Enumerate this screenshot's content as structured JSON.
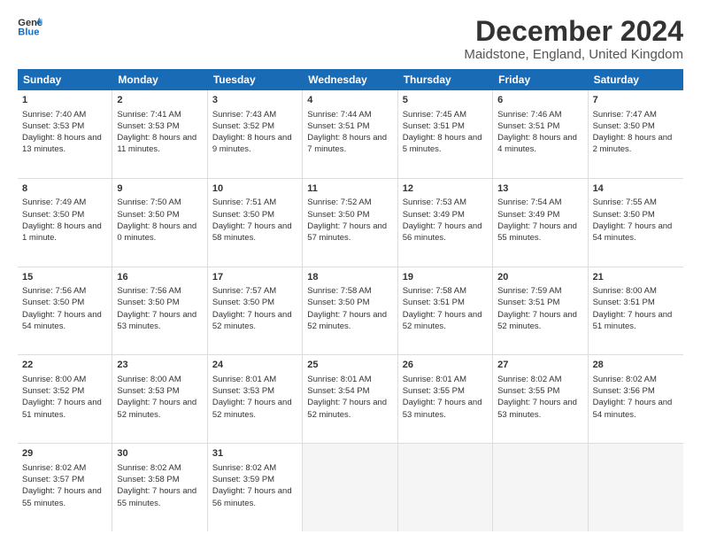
{
  "logo": {
    "line1": "General",
    "line2": "Blue"
  },
  "title": "December 2024",
  "subtitle": "Maidstone, England, United Kingdom",
  "header_days": [
    "Sunday",
    "Monday",
    "Tuesday",
    "Wednesday",
    "Thursday",
    "Friday",
    "Saturday"
  ],
  "weeks": [
    [
      {
        "day": "1",
        "rise": "7:40 AM",
        "set": "3:53 PM",
        "daylight": "8 hours and 13 minutes."
      },
      {
        "day": "2",
        "rise": "7:41 AM",
        "set": "3:53 PM",
        "daylight": "8 hours and 11 minutes."
      },
      {
        "day": "3",
        "rise": "7:43 AM",
        "set": "3:52 PM",
        "daylight": "8 hours and 9 minutes."
      },
      {
        "day": "4",
        "rise": "7:44 AM",
        "set": "3:51 PM",
        "daylight": "8 hours and 7 minutes."
      },
      {
        "day": "5",
        "rise": "7:45 AM",
        "set": "3:51 PM",
        "daylight": "8 hours and 5 minutes."
      },
      {
        "day": "6",
        "rise": "7:46 AM",
        "set": "3:51 PM",
        "daylight": "8 hours and 4 minutes."
      },
      {
        "day": "7",
        "rise": "7:47 AM",
        "set": "3:50 PM",
        "daylight": "8 hours and 2 minutes."
      }
    ],
    [
      {
        "day": "8",
        "rise": "7:49 AM",
        "set": "3:50 PM",
        "daylight": "8 hours and 1 minute."
      },
      {
        "day": "9",
        "rise": "7:50 AM",
        "set": "3:50 PM",
        "daylight": "8 hours and 0 minutes."
      },
      {
        "day": "10",
        "rise": "7:51 AM",
        "set": "3:50 PM",
        "daylight": "7 hours and 58 minutes."
      },
      {
        "day": "11",
        "rise": "7:52 AM",
        "set": "3:50 PM",
        "daylight": "7 hours and 57 minutes."
      },
      {
        "day": "12",
        "rise": "7:53 AM",
        "set": "3:49 PM",
        "daylight": "7 hours and 56 minutes."
      },
      {
        "day": "13",
        "rise": "7:54 AM",
        "set": "3:49 PM",
        "daylight": "7 hours and 55 minutes."
      },
      {
        "day": "14",
        "rise": "7:55 AM",
        "set": "3:50 PM",
        "daylight": "7 hours and 54 minutes."
      }
    ],
    [
      {
        "day": "15",
        "rise": "7:56 AM",
        "set": "3:50 PM",
        "daylight": "7 hours and 54 minutes."
      },
      {
        "day": "16",
        "rise": "7:56 AM",
        "set": "3:50 PM",
        "daylight": "7 hours and 53 minutes."
      },
      {
        "day": "17",
        "rise": "7:57 AM",
        "set": "3:50 PM",
        "daylight": "7 hours and 52 minutes."
      },
      {
        "day": "18",
        "rise": "7:58 AM",
        "set": "3:50 PM",
        "daylight": "7 hours and 52 minutes."
      },
      {
        "day": "19",
        "rise": "7:58 AM",
        "set": "3:51 PM",
        "daylight": "7 hours and 52 minutes."
      },
      {
        "day": "20",
        "rise": "7:59 AM",
        "set": "3:51 PM",
        "daylight": "7 hours and 52 minutes."
      },
      {
        "day": "21",
        "rise": "8:00 AM",
        "set": "3:51 PM",
        "daylight": "7 hours and 51 minutes."
      }
    ],
    [
      {
        "day": "22",
        "rise": "8:00 AM",
        "set": "3:52 PM",
        "daylight": "7 hours and 51 minutes."
      },
      {
        "day": "23",
        "rise": "8:00 AM",
        "set": "3:53 PM",
        "daylight": "7 hours and 52 minutes."
      },
      {
        "day": "24",
        "rise": "8:01 AM",
        "set": "3:53 PM",
        "daylight": "7 hours and 52 minutes."
      },
      {
        "day": "25",
        "rise": "8:01 AM",
        "set": "3:54 PM",
        "daylight": "7 hours and 52 minutes."
      },
      {
        "day": "26",
        "rise": "8:01 AM",
        "set": "3:55 PM",
        "daylight": "7 hours and 53 minutes."
      },
      {
        "day": "27",
        "rise": "8:02 AM",
        "set": "3:55 PM",
        "daylight": "7 hours and 53 minutes."
      },
      {
        "day": "28",
        "rise": "8:02 AM",
        "set": "3:56 PM",
        "daylight": "7 hours and 54 minutes."
      }
    ],
    [
      {
        "day": "29",
        "rise": "8:02 AM",
        "set": "3:57 PM",
        "daylight": "7 hours and 55 minutes."
      },
      {
        "day": "30",
        "rise": "8:02 AM",
        "set": "3:58 PM",
        "daylight": "7 hours and 55 minutes."
      },
      {
        "day": "31",
        "rise": "8:02 AM",
        "set": "3:59 PM",
        "daylight": "7 hours and 56 minutes."
      },
      null,
      null,
      null,
      null
    ]
  ]
}
